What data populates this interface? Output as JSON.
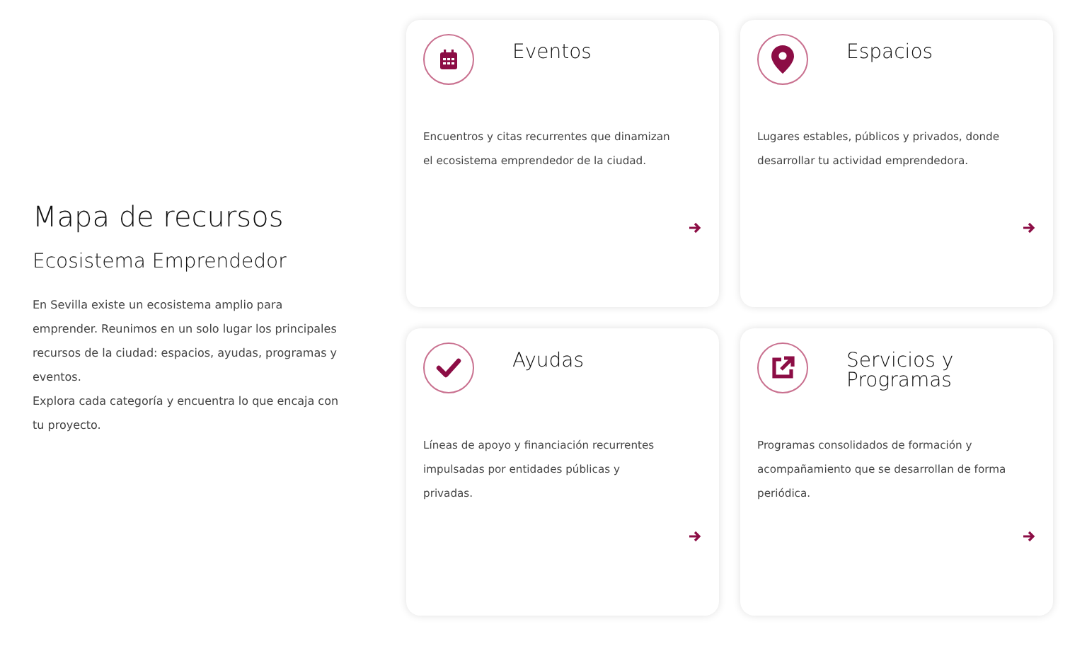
{
  "intro": {
    "title": "Mapa de recursos",
    "subtitle": "Ecosistema Emprendedor",
    "paragraphs": [
      "En Sevilla existe un ecosistema amplio para emprender. Reunimos en un solo lugar los principales recursos de la ciudad: espacios, ayudas, programas y eventos.",
      "Explora cada categoría y encuentra lo que encaja con tu proyecto."
    ]
  },
  "cards": [
    {
      "kind": "calendar",
      "title": "Eventos",
      "text": "Encuentros y citas recurrentes que dinamizan el ecosistema emprendedor de la ciudad."
    },
    {
      "kind": "pin",
      "title": "Espacios",
      "text": "Lugares estables, públicos y privados, donde desarrollar tu actividad emprendedora."
    },
    {
      "kind": "check",
      "title": "Ayudas",
      "text": "Líneas de apoyo y financiación recurrentes impulsadas por entidades públicas y privadas."
    },
    {
      "kind": "external",
      "title": "Servicios y Programas",
      "text": "Programas consolidados de formación y acompañamiento que se desarrollan de forma periódica."
    }
  ]
}
